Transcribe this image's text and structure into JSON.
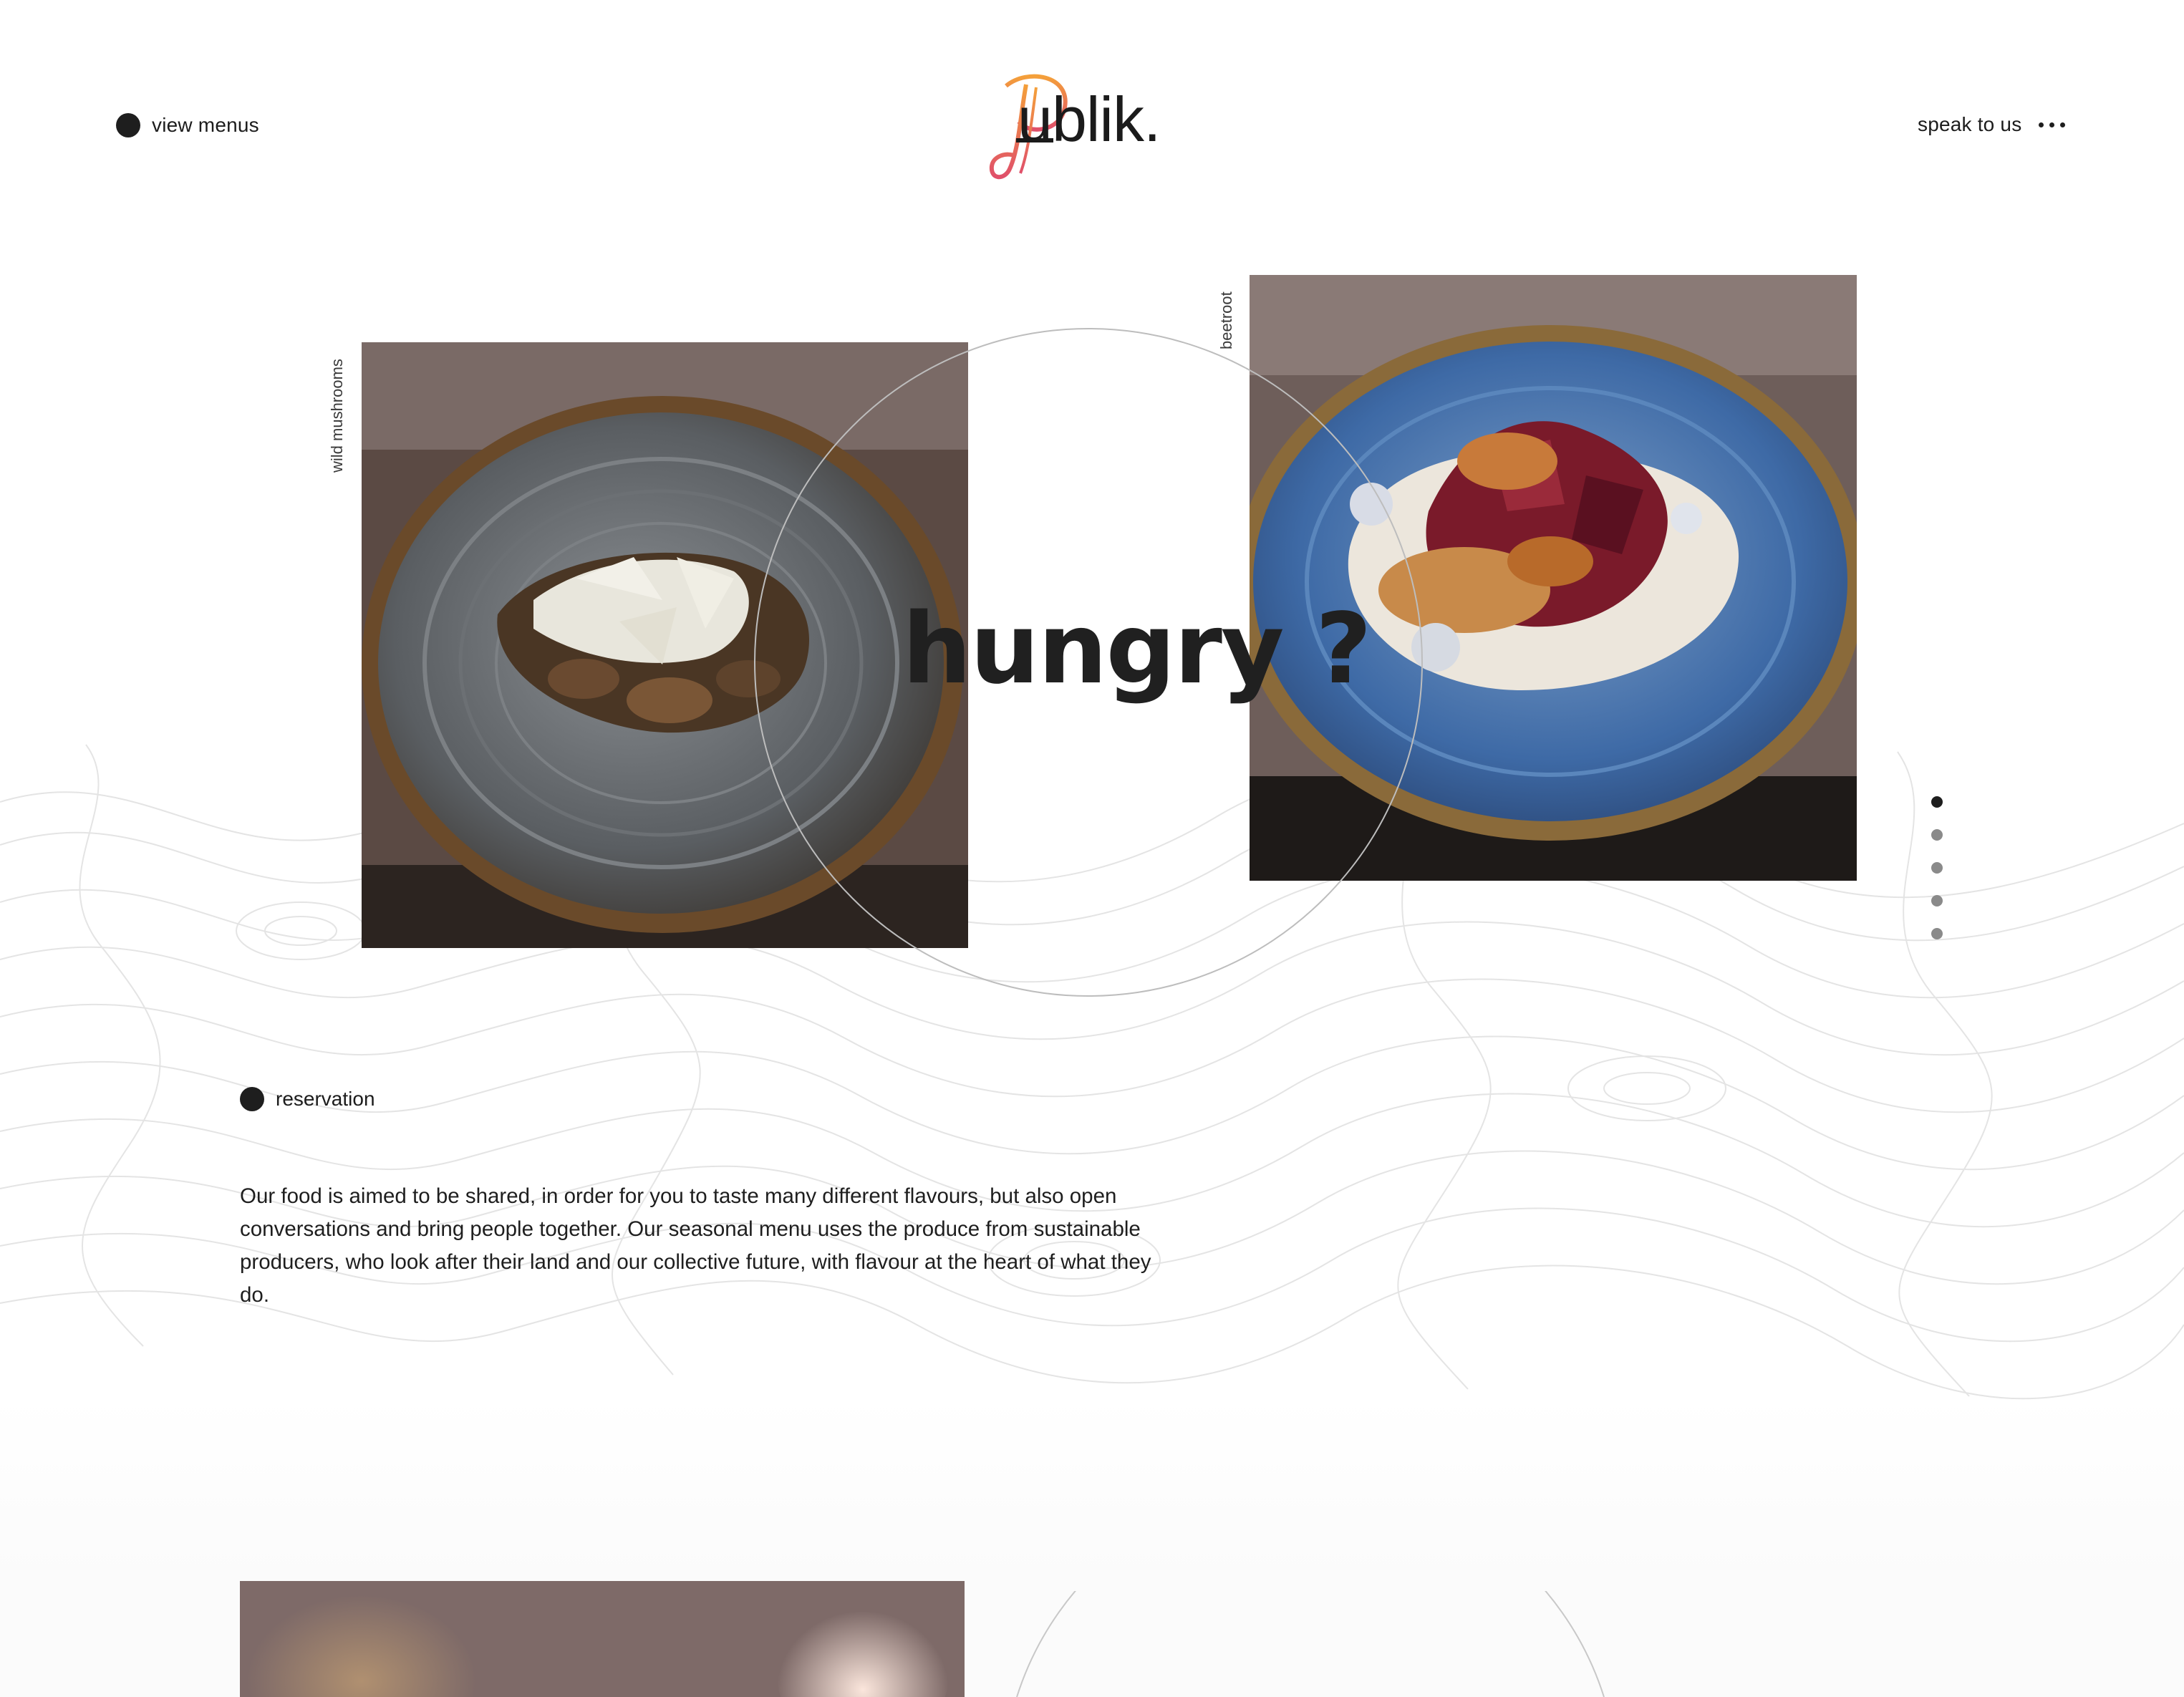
{
  "header": {
    "view_menus_label": "view menus",
    "logo_text": "ublik.",
    "speak_label": "speak to us"
  },
  "hero": {
    "title": "hungry ?"
  },
  "dishes": [
    {
      "label": "wild mushrooms"
    },
    {
      "label": "beetroot"
    }
  ],
  "pager": {
    "count": 5,
    "active": 1
  },
  "reservation": {
    "label": "reservation"
  },
  "intro": {
    "text": "Our food is aimed to be shared, in order for you to taste many different flavours, but also open conversations and bring people together. Our seasonal menu uses the produce from sustainable producers, who look after their land and our collective future, with flavour at the heart of what they do."
  },
  "colors": {
    "text": "#1c1c1c",
    "logo_gradient_start": "#f4a03a",
    "logo_gradient_end": "#e0506a",
    "background": "#ffffff"
  }
}
